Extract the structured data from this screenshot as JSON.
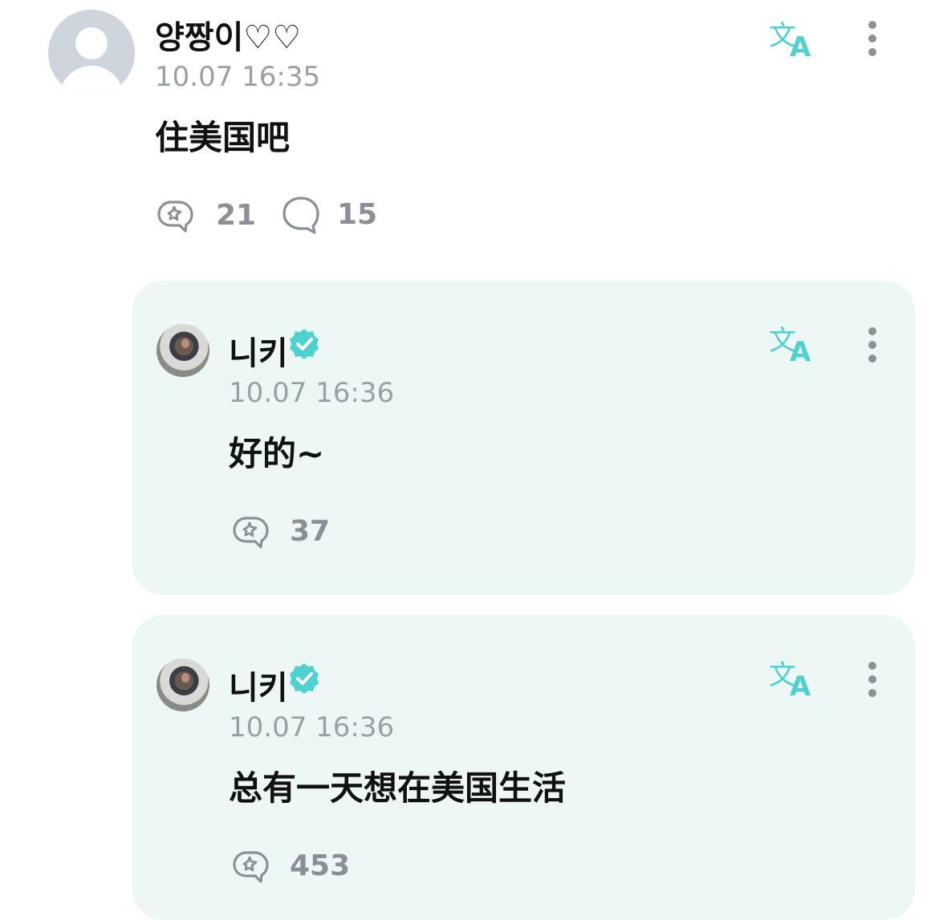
{
  "comments": [
    {
      "username": "양짱이♡♡",
      "timestamp": "10.07 16:35",
      "text": "住美国吧",
      "likes": "21",
      "replies": "15"
    }
  ],
  "replies": [
    {
      "username": "니키",
      "verified": true,
      "timestamp": "10.07 16:36",
      "text": "好的~",
      "likes": "37"
    },
    {
      "username": "니키",
      "verified": true,
      "timestamp": "10.07 16:36",
      "text": "总有一天想在美国生活",
      "likes": "453"
    }
  ],
  "colors": {
    "accent": "#4fd2cf",
    "reply_bg": "#edf8f6",
    "meta_gray": "#9ba0a6"
  },
  "icons": {
    "translate": "translate-icon",
    "more": "more-vertical-icon",
    "like": "like-icon",
    "reply": "comment-bubble-icon",
    "verified": "verified-badge-icon"
  }
}
